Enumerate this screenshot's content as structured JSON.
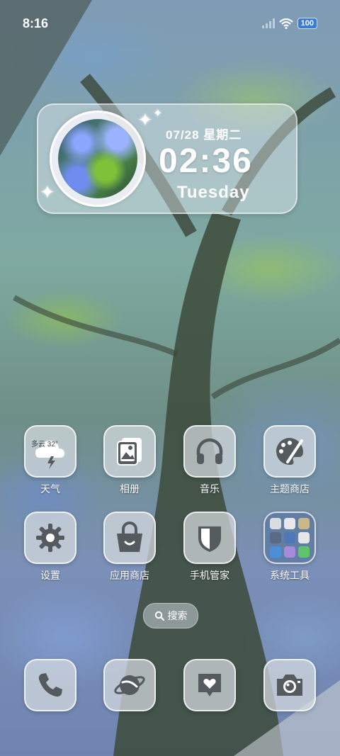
{
  "status_bar": {
    "time": "8:16",
    "battery": "100"
  },
  "clock_widget": {
    "date": "07/28 星期二",
    "time": "02:36",
    "day": "Tuesday"
  },
  "apps_row1": [
    {
      "label": "天气",
      "icon": "weather-icon"
    },
    {
      "label": "相册",
      "icon": "gallery-icon"
    },
    {
      "label": "音乐",
      "icon": "headphones-icon"
    },
    {
      "label": "主题商店",
      "icon": "palette-icon"
    }
  ],
  "apps_row2": [
    {
      "label": "设置",
      "icon": "gear-icon"
    },
    {
      "label": "应用商店",
      "icon": "shopping-bag-icon"
    },
    {
      "label": "手机管家",
      "icon": "shield-icon"
    },
    {
      "label": "系统工具",
      "icon": "folder-icon"
    }
  ],
  "weather_icon_text": {
    "condition": "多云",
    "temp": "32°"
  },
  "search": {
    "label": "搜索"
  },
  "dock": [
    {
      "icon": "phone-icon"
    },
    {
      "icon": "planet-icon"
    },
    {
      "icon": "heart-message-icon"
    },
    {
      "icon": "camera-icon"
    }
  ],
  "colors": {
    "icon_bg": "#d7dce1",
    "icon_glyph": "#555a5f",
    "widget_text": "#ffffff"
  }
}
